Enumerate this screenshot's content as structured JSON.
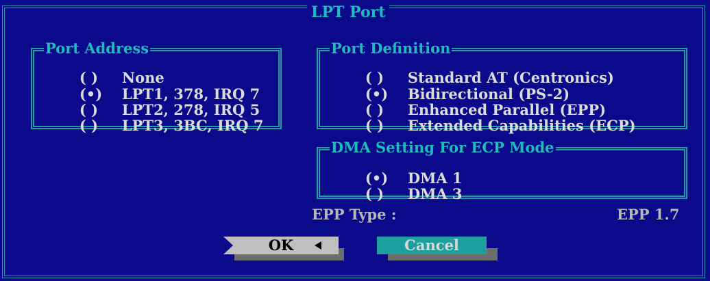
{
  "dialog": {
    "title": "LPT Port"
  },
  "port_address": {
    "title": "Port Address",
    "options": [
      {
        "radio": "( )",
        "label": "None"
      },
      {
        "radio": "(•)",
        "label": "LPT1, 378, IRQ 7"
      },
      {
        "radio": "( )",
        "label": "LPT2, 278, IRQ 5"
      },
      {
        "radio": "( )",
        "label": "LPT3, 3BC, IRQ 7"
      }
    ]
  },
  "port_definition": {
    "title": "Port Definition",
    "options": [
      {
        "radio": "( )",
        "label": "Standard AT (Centronics)"
      },
      {
        "radio": "(•)",
        "label": "Bidirectional (PS-2)"
      },
      {
        "radio": "( )",
        "label": "Enhanced Parallel (EPP)"
      },
      {
        "radio": "( )",
        "label": "Extended Capabilities (ECP)"
      }
    ]
  },
  "dma": {
    "title": "DMA Setting For ECP Mode",
    "options": [
      {
        "radio": "(•)",
        "label": "DMA 1"
      },
      {
        "radio": "( )",
        "label": "DMA 3"
      }
    ]
  },
  "epp": {
    "label": "EPP Type :",
    "value": "EPP 1.7"
  },
  "buttons": {
    "ok": "OK",
    "cancel": "Cancel"
  },
  "colors": {
    "background": "#0a0a8a",
    "frame": "#1e9e9e",
    "text": "#dcdcdc"
  }
}
